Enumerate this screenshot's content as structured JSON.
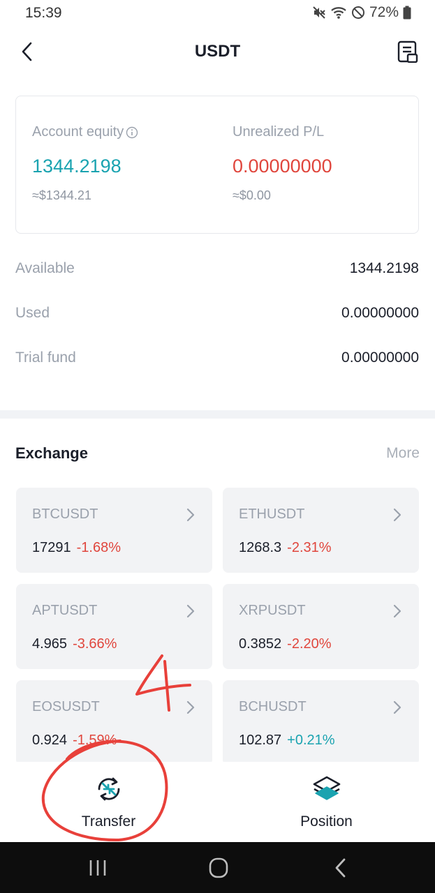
{
  "status_bar": {
    "time": "15:39",
    "battery": "72%",
    "icons": [
      "mute-icon",
      "wifi-icon",
      "do-not-disturb-icon",
      "battery-icon"
    ]
  },
  "nav": {
    "title": "USDT",
    "back_icon": "chevron-left-icon",
    "records_icon": "records-icon"
  },
  "equity": {
    "equity_label": "Account equity",
    "equity_value": "1344.2198",
    "equity_fiat": "≈$1344.21",
    "pl_label": "Unrealized P/L",
    "pl_value": "0.00000000",
    "pl_fiat": "≈$0.00"
  },
  "balances": [
    {
      "label": "Available",
      "value": "1344.2198"
    },
    {
      "label": "Used",
      "value": "0.00000000"
    },
    {
      "label": "Trial fund",
      "value": "0.00000000"
    }
  ],
  "exchange": {
    "title": "Exchange",
    "more": "More",
    "tickers": [
      {
        "symbol": "BTCUSDT",
        "price": "17291",
        "change": "-1.68%",
        "direction": "down"
      },
      {
        "symbol": "ETHUSDT",
        "price": "1268.3",
        "change": "-2.31%",
        "direction": "down"
      },
      {
        "symbol": "APTUSDT",
        "price": "4.965",
        "change": "-3.66%",
        "direction": "down"
      },
      {
        "symbol": "XRPUSDT",
        "price": "0.3852",
        "change": "-2.20%",
        "direction": "down"
      },
      {
        "symbol": "EOSUSDT",
        "price": "0.924",
        "change": "-1.59%",
        "direction": "down"
      },
      {
        "symbol": "BCHUSDT",
        "price": "102.87",
        "change": "+0.21%",
        "direction": "up"
      }
    ]
  },
  "bottom_tabs": [
    {
      "label": "Transfer",
      "icon": "transfer-icon"
    },
    {
      "label": "Position",
      "icon": "layers-icon"
    }
  ],
  "annotation": {
    "number": "4",
    "color": "#e8403a"
  },
  "colors": {
    "accent_teal": "#1aa3b0",
    "loss_red": "#e0463d",
    "muted_text": "#9aa1ac"
  }
}
